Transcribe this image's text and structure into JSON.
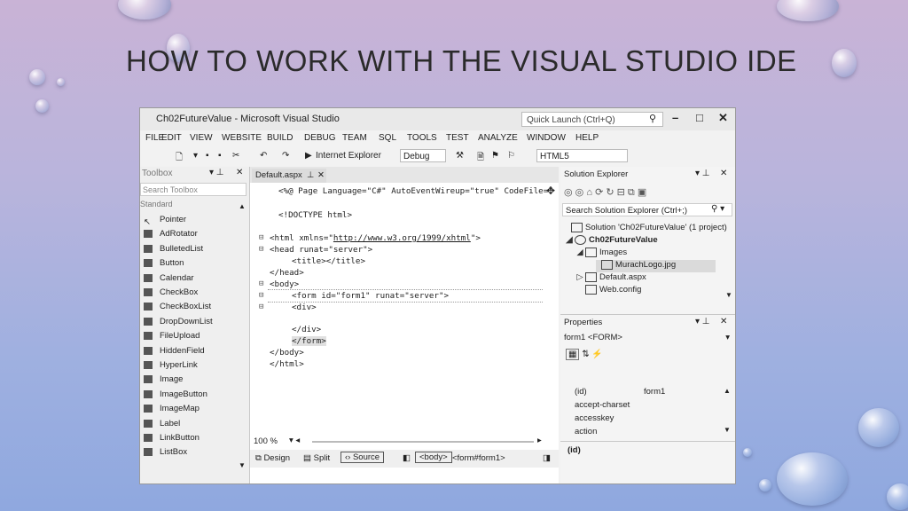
{
  "slide": {
    "title": "HOW TO WORK WITH THE VISUAL STUDIO IDE"
  },
  "window": {
    "title": "Ch02FutureValue - Microsoft Visual Studio",
    "quick_launch": "Quick Launch (Ctrl+Q)",
    "minimize": "–",
    "maximize": "□",
    "close": "✕"
  },
  "menu": [
    "FILE",
    "EDIT",
    "VIEW",
    "WEBSITE",
    "BUILD",
    "DEBUG",
    "TEAM",
    "SQL",
    "TOOLS",
    "TEST",
    "ANALYZE",
    "WINDOW",
    "HELP"
  ],
  "toolbar": {
    "browser": "Internet Explorer",
    "config": "Debug",
    "target": "HTML5"
  },
  "toolbox": {
    "header": "Toolbox",
    "search_placeholder": "Search Toolbox",
    "group": "Standard",
    "items": [
      "Pointer",
      "AdRotator",
      "BulletedList",
      "Button",
      "Calendar",
      "CheckBox",
      "CheckBoxList",
      "DropDownList",
      "FileUpload",
      "HiddenField",
      "HyperLink",
      "Image",
      "ImageButton",
      "ImageMap",
      "Label",
      "LinkButton",
      "ListBox"
    ]
  },
  "editor": {
    "tab": "Default.aspx",
    "lines": {
      "l1": "<%@ Page Language=\"C#\" AutoEventWireup=\"true\" CodeFile=\"",
      "l2": "<!DOCTYPE html>",
      "l3a": "<html xmlns=\"",
      "l3b": "http://www.w3.org/1999/xhtml",
      "l3c": "\">",
      "l4": "<head runat=\"server\">",
      "l5": "<title></title>",
      "l6": "</head>",
      "l7": "<body>",
      "l8": "<form id=\"form1\" runat=\"server\">",
      "l9": "<div>",
      "l10": "</div>",
      "l11": "</form>",
      "l12": "</body>",
      "l13": "</html>"
    },
    "zoom": "100 %",
    "views": {
      "design": "Design",
      "split": "Split",
      "source": "Source"
    },
    "path": {
      "body": "<body>",
      "form": "<form#form1>"
    }
  },
  "solution_explorer": {
    "header": "Solution Explorer",
    "search_placeholder": "Search Solution Explorer (Ctrl+;)",
    "nodes": {
      "solution": "Solution 'Ch02FutureValue' (1 project)",
      "project": "Ch02FutureValue",
      "images": "Images",
      "logo": "MurachLogo.jpg",
      "default": "Default.aspx",
      "config": "Web.config"
    }
  },
  "properties": {
    "header": "Properties",
    "object": "form1 <FORM>",
    "rows": [
      {
        "name": "(id)",
        "value": "form1"
      },
      {
        "name": "accept-charset",
        "value": ""
      },
      {
        "name": "accesskey",
        "value": ""
      },
      {
        "name": "action",
        "value": ""
      }
    ],
    "description": "(id)"
  }
}
